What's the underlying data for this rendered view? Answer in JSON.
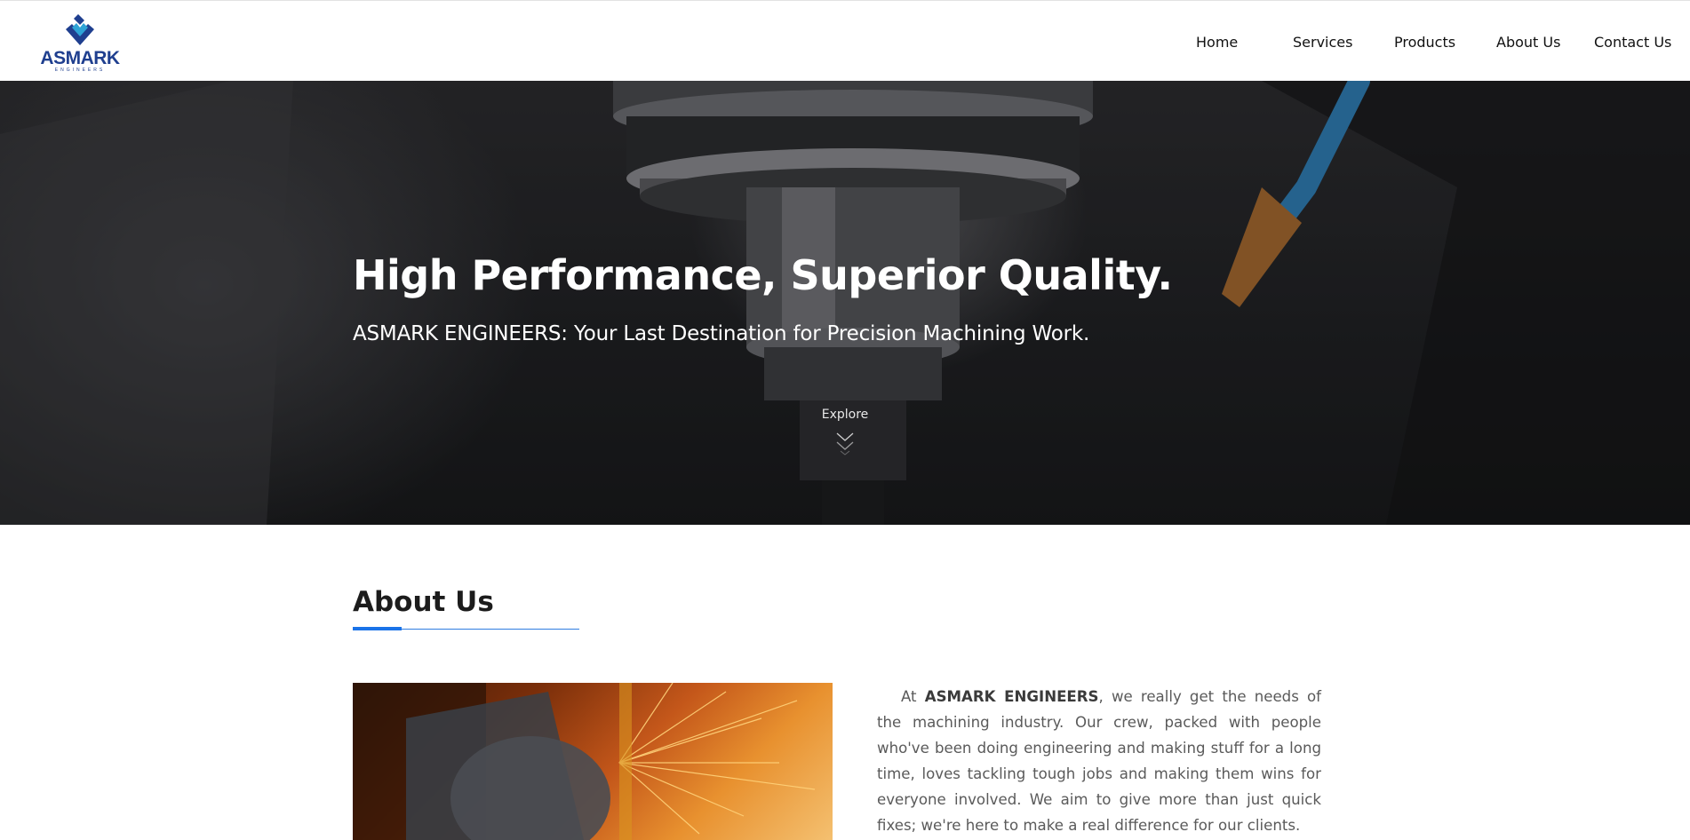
{
  "brand": {
    "logo_text": "ASMARK",
    "logo_subtext": "ENGINEERS",
    "colors": {
      "primary": "#1f3f8f",
      "accent": "#2ea3d6",
      "link_blue": "#1a73e8"
    }
  },
  "nav": {
    "items": [
      {
        "label": "Home"
      },
      {
        "label": "Services"
      },
      {
        "label": "Products"
      },
      {
        "label": "About Us"
      },
      {
        "label": "Contact Us"
      }
    ]
  },
  "hero": {
    "title": "High Performance, Superior Quality.",
    "subtitle": "ASMARK ENGINEERS: Your Last Destination for Precision Machining Work.",
    "explore_label": "Explore",
    "explore_icon": "double-chevron-down-icon"
  },
  "about": {
    "heading": "About Us",
    "paragraph_prefix": "At ",
    "paragraph_bold": "ASMARK ENGINEERS",
    "paragraph_rest": ", we really get the needs of the machining industry. Our crew, packed with people who've been doing engineering and making stuff for a long time, loves tackling tough jobs and making them wins for everyone involved. We aim to give more than just quick fixes; we're here to make a real difference for our clients."
  }
}
